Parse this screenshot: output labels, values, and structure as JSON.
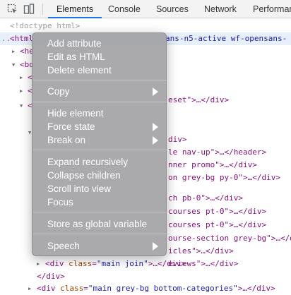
{
  "toolbar": {
    "tabs": [
      {
        "label": "Elements"
      },
      {
        "label": "Console"
      },
      {
        "label": "Sources"
      },
      {
        "label": "Network"
      },
      {
        "label": "Performance"
      }
    ],
    "icons": [
      "inspect-element-icon",
      "device-toolbar-icon"
    ]
  },
  "tree": {
    "doctype": "<!doctype html>",
    "html_line": {
      "prefix": "...",
      "tag_open": "<html",
      "partial_class": "ans-n5-active wf-opensans-"
    },
    "lines": {
      "he": "<he",
      "bo": "<bo",
      "lt1": "<",
      "lt2": "<",
      "lt3": "<",
      "eset": "eset\">…</div>",
      "div_close": "div>",
      "header": "le nav-up\">…</header>",
      "promo": "nner promo\">…</div>",
      "grey_bg": "on grey-bg py-0\">…</div>",
      "pb0": "ch pb-0\">…</div>",
      "courses1": "courses pt-0\">…</div>",
      "courses2": "courses pt-0\">…</div>",
      "course_section": "ourse-section grey-bg\">…</div",
      "articles": "icles\">…</div>",
      "reviews": "eviews\">…</div>",
      "join": {
        "tag": "<div",
        "attr": "class",
        "val": "\"main join\"",
        "rest": ">…</div>"
      },
      "div_end": "</div>",
      "bottom": {
        "tag": "<div",
        "attr": "class",
        "val": "\"main grey-bg bottom-categories\"",
        "rest": ">…</div>"
      }
    }
  },
  "context_menu": {
    "group1": [
      "Add attribute",
      "Edit as HTML",
      "Delete element"
    ],
    "copy": "Copy",
    "group3": [
      "Hide element",
      "Force state",
      "Break on"
    ],
    "group4": [
      "Expand recursively",
      "Collapse children",
      "Scroll into view",
      "Focus"
    ],
    "store": "Store as global variable",
    "speech": "Speech"
  },
  "colors": {
    "tag": "#881280",
    "attr": "#994500",
    "value": "#1a1aa6",
    "active_tab": "#1a73e8",
    "menu_bg": "#9e9ea0"
  }
}
